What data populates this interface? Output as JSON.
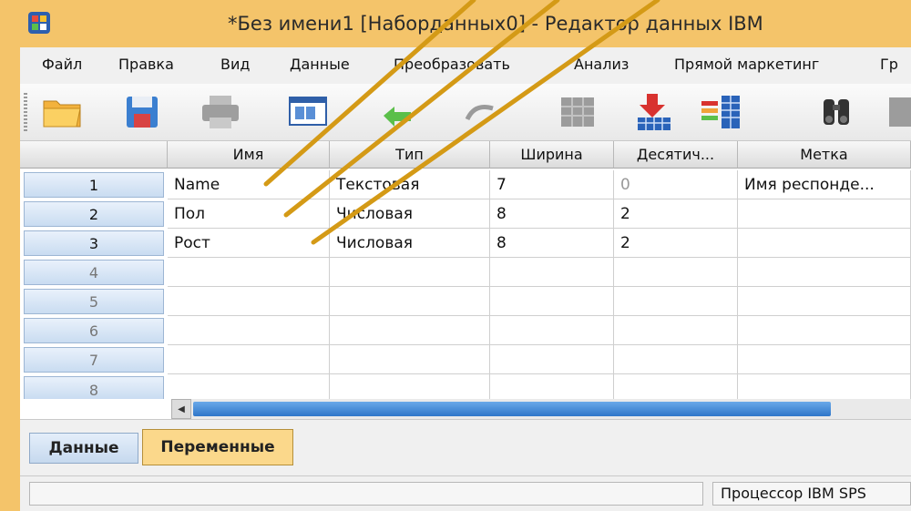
{
  "window": {
    "title": "*Без имени1 [Наборданных0] - Редактор данных IBM"
  },
  "menu": [
    {
      "label": "Файл"
    },
    {
      "label": "Правка"
    },
    {
      "label": "Вид"
    },
    {
      "label": "Данные"
    },
    {
      "label": "Преобразовать"
    },
    {
      "label": "Анализ"
    },
    {
      "label": "Прямой маркетинг"
    },
    {
      "label": "Гр"
    }
  ],
  "toolbar": {
    "icons": [
      "open-folder-icon",
      "save-icon",
      "print-icon",
      "recall-dialog-icon",
      "undo-icon",
      "redo-icon",
      "goto-case-icon",
      "insert-cases-icon",
      "insert-variable-icon",
      "find-icon",
      "split-file-icon"
    ]
  },
  "grid": {
    "columns": [
      "Имя",
      "Тип",
      "Ширина",
      "Десятич...",
      "Метка"
    ],
    "rows": [
      {
        "num": "1",
        "name": "Name",
        "type": "Текстовая",
        "width": "7",
        "decimals": "0",
        "label": "Имя респонде..."
      },
      {
        "num": "2",
        "name": "Пол",
        "type": "Числовая",
        "width": "8",
        "decimals": "2",
        "label": ""
      },
      {
        "num": "3",
        "name": "Рост",
        "type": "Числовая",
        "width": "8",
        "decimals": "2",
        "label": ""
      },
      {
        "num": "4",
        "name": "",
        "type": "",
        "width": "",
        "decimals": "",
        "label": ""
      },
      {
        "num": "5",
        "name": "",
        "type": "",
        "width": "",
        "decimals": "",
        "label": ""
      },
      {
        "num": "6",
        "name": "",
        "type": "",
        "width": "",
        "decimals": "",
        "label": ""
      },
      {
        "num": "7",
        "name": "",
        "type": "",
        "width": "",
        "decimals": "",
        "label": ""
      },
      {
        "num": "8",
        "name": "",
        "type": "",
        "width": "",
        "decimals": "",
        "label": ""
      }
    ]
  },
  "tabs": {
    "data": "Данные",
    "variables": "Переменные"
  },
  "status": {
    "processor": "Процессор IBM SPS"
  },
  "colors": {
    "title_bg": "#f4c46a",
    "overlay_stroke": "#d49a16",
    "scroll_thumb": "#3a83d2"
  }
}
